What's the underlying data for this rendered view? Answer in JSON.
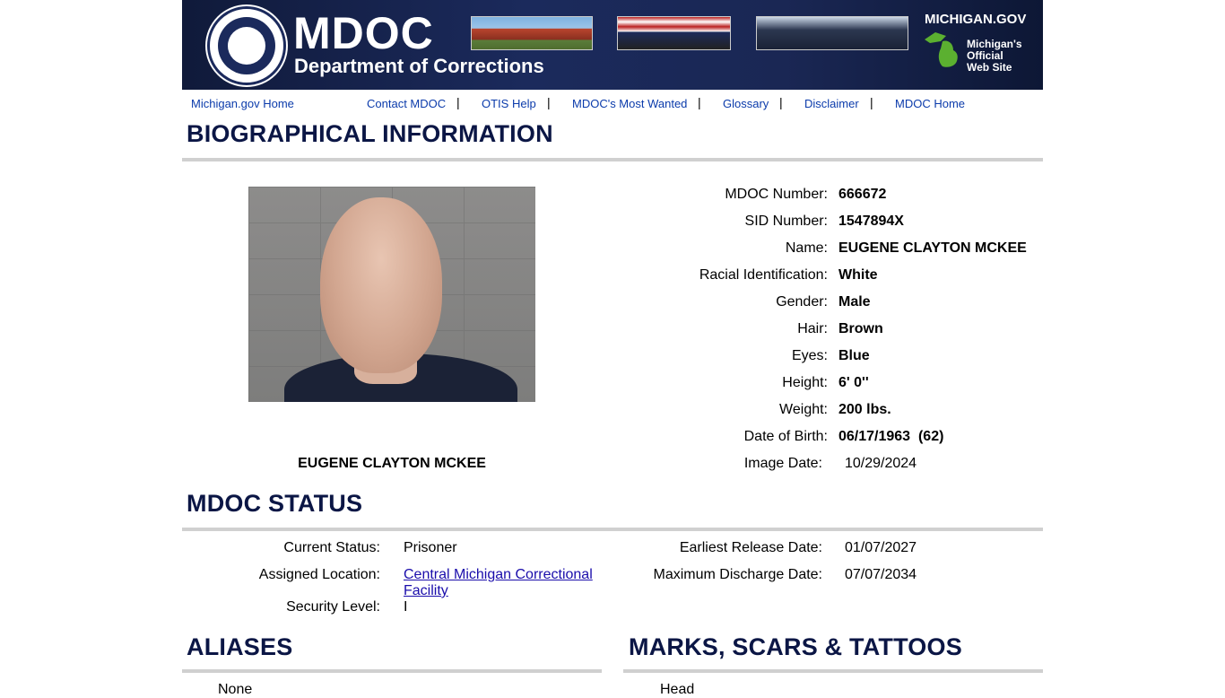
{
  "banner": {
    "brand": "MDOC",
    "department": "Department of Corrections",
    "michigan_gov": "MICHIGAN.GOV",
    "official_line1": "Michigan's",
    "official_line2": "Official",
    "official_line3": "Web Site"
  },
  "nav": {
    "home": "Michigan.gov Home",
    "contact": "Contact MDOC",
    "otis": "OTIS Help",
    "wanted": "MDOC's Most Wanted",
    "glossary": "Glossary",
    "disclaimer": "Disclaimer",
    "mdoc_home": "MDOC Home",
    "separator": "|"
  },
  "bio": {
    "title": "BIOGRAPHICAL INFORMATION",
    "caption": "EUGENE CLAYTON MCKEE",
    "fields": [
      {
        "label": "MDOC Number:",
        "value": "666672"
      },
      {
        "label": "SID Number:",
        "value": "1547894X"
      },
      {
        "label": "Name:",
        "value": "EUGENE CLAYTON MCKEE"
      },
      {
        "label": "Racial Identification:",
        "value": "White"
      },
      {
        "label": "Gender:",
        "value": "Male"
      },
      {
        "label": "Hair:",
        "value": "Brown"
      },
      {
        "label": "Eyes:",
        "value": "Blue"
      },
      {
        "label": "Height:",
        "value": "6' 0''"
      },
      {
        "label": "Weight:",
        "value": "200 lbs."
      },
      {
        "label": "Date of Birth:",
        "value": "06/17/1963  (62)"
      },
      {
        "label": "Image Date:",
        "value": "10/29/2024"
      }
    ]
  },
  "status": {
    "title": "MDOC STATUS",
    "current_status_label": "Current Status:",
    "current_status": "Prisoner",
    "location_label": "Assigned Location:",
    "location_line1": "Central Michigan Correctional",
    "location_line2": "Facility",
    "security_label": "Security Level:",
    "security": "I",
    "erd_label": "Earliest Release Date:",
    "erd": "01/07/2027",
    "mdd_label": "Maximum Discharge Date:",
    "mdd": "07/07/2034"
  },
  "aliases": {
    "title": "ALIASES",
    "first": "None"
  },
  "marks": {
    "title": "MARKS, SCARS & TATTOOS",
    "first": "Head"
  },
  "colors": {
    "banner": "#1b2a5c",
    "heading": "#0b1645",
    "nav_link": "#0b3bab",
    "rule": "#d0d0d0"
  }
}
